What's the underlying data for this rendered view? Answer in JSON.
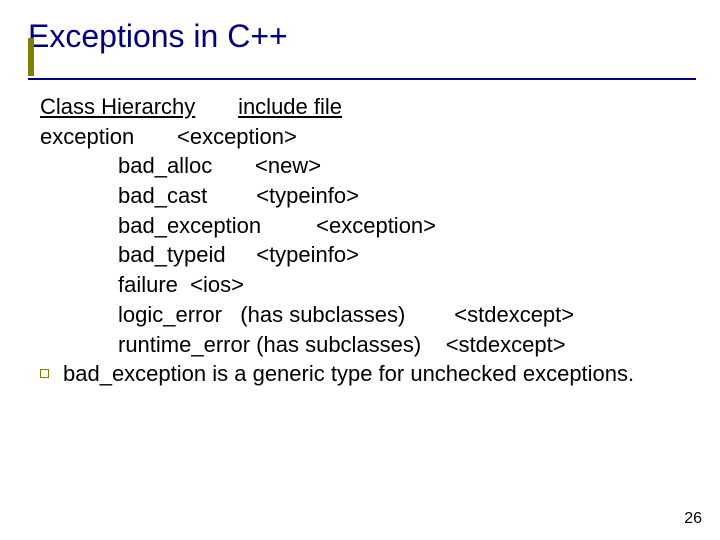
{
  "title": "Exceptions in C++",
  "headers": {
    "class_hierarchy": "Class Hierarchy",
    "include_file": "include file"
  },
  "rows": [
    {
      "name": "exception",
      "include": "<exception>",
      "note": "",
      "indent": 0
    },
    {
      "name": "bad_alloc",
      "include": "<new>",
      "note": "",
      "indent": 1
    },
    {
      "name": "bad_cast",
      "include": "<typeinfo>",
      "note": "",
      "indent": 1
    },
    {
      "name": "bad_exception",
      "include": "<exception>",
      "note": "",
      "indent": 1
    },
    {
      "name": "bad_typeid",
      "include": "<typeinfo>",
      "note": "",
      "indent": 1
    },
    {
      "name": "failure",
      "include": "<ios>",
      "note": "",
      "indent": 1
    },
    {
      "name": "logic_error",
      "include": "<stdexcept>",
      "note": "(has subclasses)",
      "indent": 1
    },
    {
      "name": "runtime_error",
      "include": "<stdexcept>",
      "note": "(has subclasses)",
      "indent": 1
    }
  ],
  "bullet": "bad_exception is a generic type for unchecked exceptions.",
  "page_number": "26"
}
